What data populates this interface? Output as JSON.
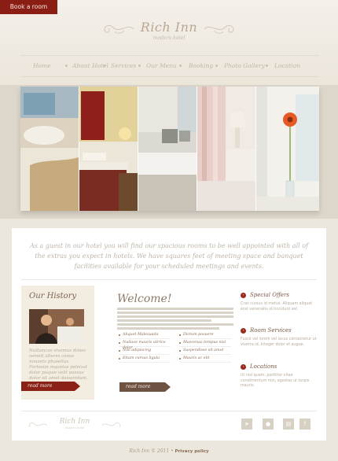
{
  "header": {
    "book_label": "Book a room",
    "logo_name": "Rich Inn",
    "logo_tagline": "modern hotel"
  },
  "nav": {
    "items": [
      "Home",
      "About Hotel",
      "Services",
      "Our Menu",
      "Booking",
      "Photo Gallery",
      "Location"
    ]
  },
  "intro": {
    "text": "As a guest in our hotel you will find our spacious rooms to be well appointed with all of the extras you expect in hotels. We have squares feet of meeting space and banquet facilities available for your scheduled meetings and events."
  },
  "history": {
    "title": "Our History",
    "text": "Nullamcas vivamus donec semeit alteres conse nouaets phasellus. Fortesun mquetos peleisat dolor poquie velit passus dolor sit amet duiseindum.",
    "read_more": "read more"
  },
  "welcome": {
    "title": "Welcome!",
    "bullets_left": [
      "Aliquet Malesuada",
      "Nullaoe mauris ultrice dolor",
      "Nisi adipiscing",
      "Etiam cursus ligula"
    ],
    "bullets_right": [
      "Dictum posuere",
      "Maecenas tempus nisl",
      "Suspendisse sit amet",
      "Mauris ac elit"
    ],
    "read_more": "read more"
  },
  "sidebar": {
    "sections": [
      {
        "title": "Special Offers",
        "text": "Cras cursus id metus. Aliquam aliquet erat venenatis id tincidunt est."
      },
      {
        "title": "Room Services",
        "text": "Fusce vel lorem vel lacus consectetur ut viverra id. Integer dolor et augue."
      },
      {
        "title": "Locations",
        "text": "Ut nisi quam, porttitor vitae condimentum non, egestas ut turpis mauris."
      }
    ]
  },
  "footer": {
    "logo_name": "Rich Inn",
    "logo_tagline": "modern hotel",
    "social_icons": [
      "twitter-icon",
      "flickr-icon",
      "blogger-icon",
      "facebook-icon"
    ],
    "copyright": "Rich Inn © 2011 •",
    "privacy_label": "Privacy policy"
  },
  "colors": {
    "accent": "#8b1e14",
    "background": "#ece7dc",
    "text_muted": "#bfb5aa"
  }
}
